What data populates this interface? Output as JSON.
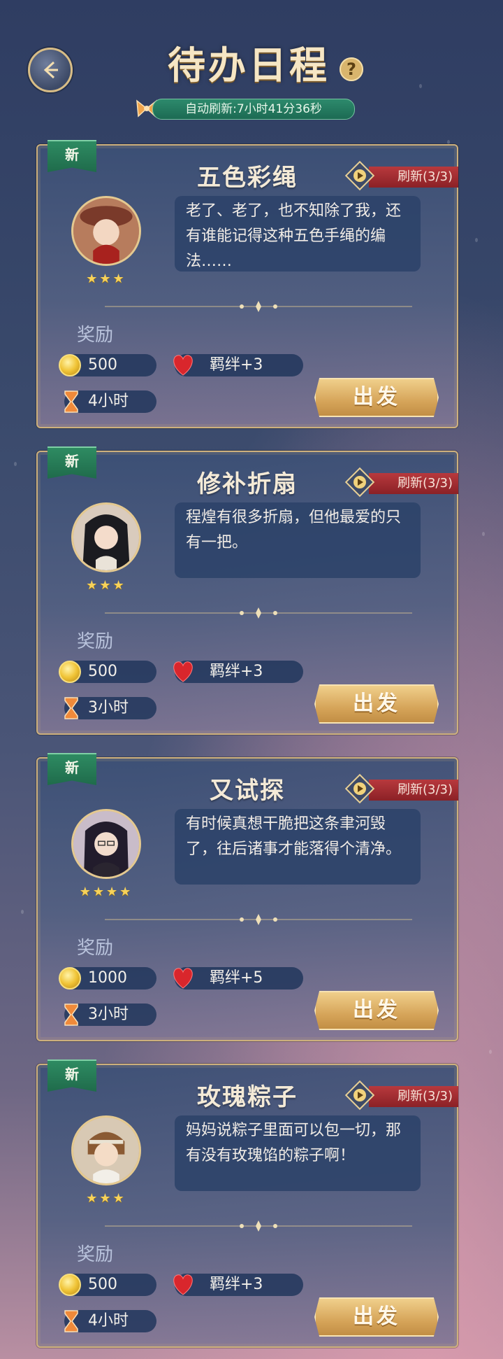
{
  "header": {
    "title": "待办日程",
    "help_label": "?",
    "auto_refresh": "自动刷新:7小时41分36秒"
  },
  "cards": [
    {
      "badge": "新",
      "title": "五色彩绳",
      "refresh": "刷新(3/3)",
      "stars": "★★★",
      "dialog": "老了、老了，也不知除了我，还有谁能记得这种五色手绳的编法……",
      "reward_label": "奖励",
      "coins": "500",
      "bond": "羁绊+3",
      "duration": "4小时",
      "go_label": "出发"
    },
    {
      "badge": "新",
      "title": "修补折扇",
      "refresh": "刷新(3/3)",
      "stars": "★★★",
      "dialog": "程煌有很多折扇，但他最爱的只有一把。",
      "reward_label": "奖励",
      "coins": "500",
      "bond": "羁绊+3",
      "duration": "3小时",
      "go_label": "出发"
    },
    {
      "badge": "新",
      "title": "又试探",
      "refresh": "刷新(3/3)",
      "stars": "★★★★",
      "dialog": "有时候真想干脆把这条聿河毁了，往后诸事才能落得个清净。",
      "reward_label": "奖励",
      "coins": "1000",
      "bond": "羁绊+5",
      "duration": "3小时",
      "go_label": "出发"
    },
    {
      "badge": "新",
      "title": "玫瑰粽子",
      "refresh": "刷新(3/3)",
      "stars": "★★★",
      "dialog": "妈妈说粽子里面可以包一切，那有没有玫瑰馅的粽子啊！",
      "reward_label": "奖励",
      "coins": "500",
      "bond": "羁绊+3",
      "duration": "4小时",
      "go_label": "出发"
    }
  ]
}
